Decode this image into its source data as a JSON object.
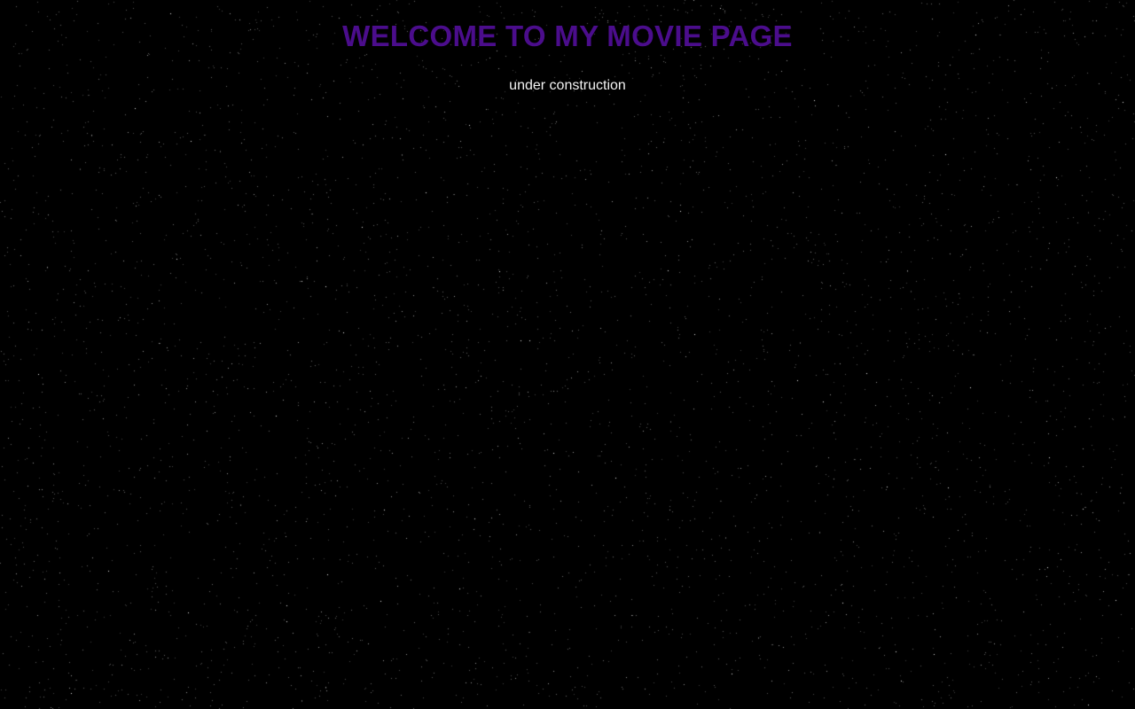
{
  "page": {
    "title": "WELCOME TO MY MOVIE PAGE",
    "subtitle": "under construction"
  },
  "colors": {
    "background": "#000000",
    "title": "#4b0d8c",
    "subtitle": "#f2f2f2",
    "stars": "#ffffff"
  }
}
